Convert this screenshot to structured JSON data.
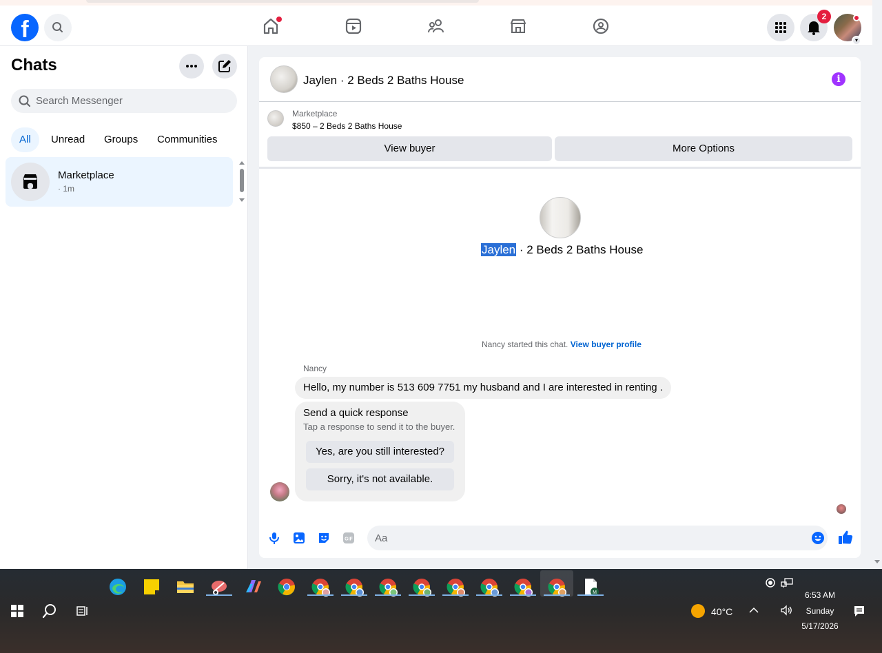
{
  "navbar": {
    "logo": "f",
    "notifications_count": "2"
  },
  "sidebar": {
    "title": "Chats",
    "search_placeholder": "Search Messenger",
    "filters": [
      "All",
      "Unread",
      "Groups",
      "Communities"
    ],
    "active_filter": "All",
    "chats": [
      {
        "name": "Marketplace",
        "meta": "· 1m"
      }
    ]
  },
  "conversation": {
    "title": "Jaylen · 2 Beds 2 Baths House",
    "marketplace_label": "Marketplace",
    "listing": "$850 – 2 Beds 2 Baths House",
    "view_buyer_label": "View buyer",
    "more_options_label": "More Options",
    "profile_name_highlight": "Jaylen",
    "profile_name_rest": " · 2 Beds 2 Baths House",
    "started_text": "Nancy started this chat. ",
    "view_buyer_profile": "View buyer profile",
    "sender": "Nancy",
    "message": "Hello, my number is 513 609 7751 my husband and I are interested in renting .",
    "quick_response": {
      "title": "Send a quick response",
      "subtitle": "Tap a response to send it to the buyer.",
      "options": [
        "Yes, are you still interested?",
        "Sorry, it's not available."
      ]
    },
    "composer_placeholder": "Aa"
  },
  "taskbar": {
    "weather": "40°C",
    "time": "6:53 AM",
    "day": "Sunday",
    "date": "5/17/2026"
  },
  "colors": {
    "brand_blue": "#0866ff",
    "link_blue": "#0064d1",
    "info_purple": "#a033ff",
    "badge_red": "#e41e3f"
  }
}
